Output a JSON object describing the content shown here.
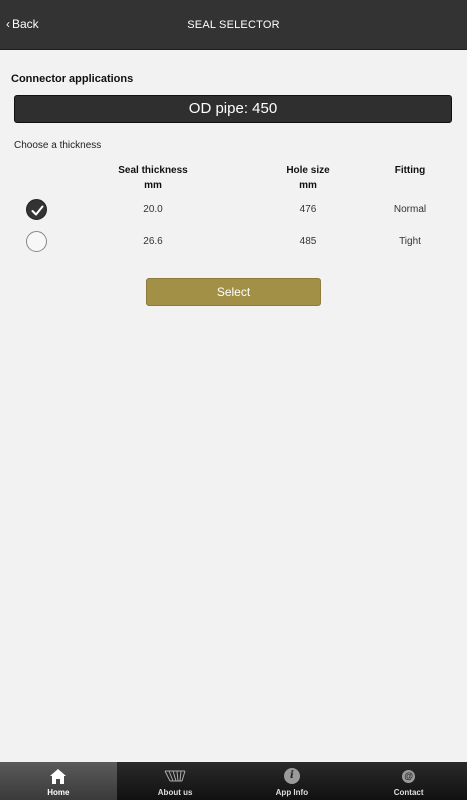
{
  "header": {
    "back_label": "Back",
    "title": "SEAL SELECTOR"
  },
  "section_title": "Connector applications",
  "od_pipe": "OD pipe: 450",
  "choose_label": "Choose a thickness",
  "table": {
    "headers": {
      "thickness": "Seal thickness",
      "thickness_unit": "mm",
      "hole": "Hole size",
      "hole_unit": "mm",
      "fitting": "Fitting"
    },
    "rows": [
      {
        "selected": true,
        "thickness": "20.0",
        "hole": "476",
        "fitting": "Normal"
      },
      {
        "selected": false,
        "thickness": "26.6",
        "hole": "485",
        "fitting": "Tight"
      }
    ]
  },
  "select_label": "Select",
  "tabs": [
    {
      "label": "Home",
      "icon": "home-icon",
      "active": true
    },
    {
      "label": "About us",
      "icon": "logo-icon",
      "active": false
    },
    {
      "label": "App Info",
      "icon": "info-icon",
      "active": false
    },
    {
      "label": "Contact",
      "icon": "at-icon",
      "active": false
    }
  ],
  "colors": {
    "header": "#333333",
    "accent": "#a39047",
    "background": "#f2f2f2"
  }
}
